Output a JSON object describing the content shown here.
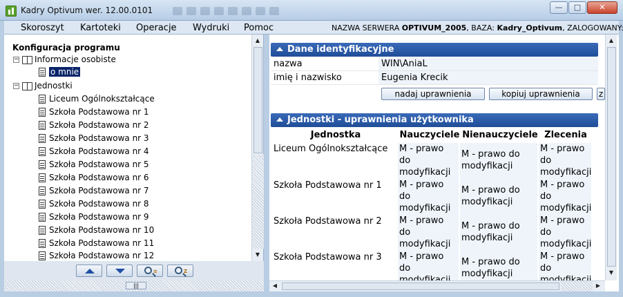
{
  "window": {
    "title": "Kadry Optivum wer. 12.00.0101",
    "minimize_label": "—",
    "maximize_label": "□",
    "close_label": "✕"
  },
  "menu": {
    "items": [
      "Skoroszyt",
      "Kartoteki",
      "Operacje",
      "Wydruki",
      "Pomoc"
    ],
    "server_label": "NAZWA SERWERA",
    "server_value": "OPTIVUM_2005",
    "db_label": ", BAZA:",
    "db_value": "Kadry_Optivum",
    "user_label": ", ZALOGOWANY:"
  },
  "tree": {
    "root": "Konfiguracja programu",
    "group1": "Informacje osobiste",
    "group1_items": [
      "o mnie"
    ],
    "group2": "Jednostki",
    "group2_items": [
      "Liceum Ogólnokształcące",
      "Szkoła Podstawowa nr 1",
      "Szkoła Podstawowa nr 2",
      "Szkoła Podstawowa nr 3",
      "Szkoła Podstawowa nr 4",
      "Szkoła Podstawowa nr 5",
      "Szkoła Podstawowa nr 6",
      "Szkoła Podstawowa nr 7",
      "Szkoła Podstawowa nr 8",
      "Szkoła Podstawowa nr 9",
      "Szkoła Podstawowa nr 10",
      "Szkoła Podstawowa nr 11",
      "Szkoła Podstawowa nr 12"
    ]
  },
  "identity": {
    "header": "Dane identyfikacyjne",
    "rows": [
      {
        "label": "nazwa",
        "value": "WIN\\AniaL"
      },
      {
        "label": "imię i nazwisko",
        "value": "Eugenia Krecik"
      }
    ],
    "grant_button": "nadaj uprawnienia",
    "copy_button": "kopiuj uprawnienia",
    "more_button": "z"
  },
  "permissions": {
    "header": "Jednostki - uprawnienia użytkownika",
    "columns": [
      "Jednostka",
      "Nauczyciele",
      "Nienauczyciele",
      "Zlecenia"
    ],
    "rows": [
      {
        "unit": "Liceum Ogólnokształcące",
        "nauczyciele": [
          "M - prawo",
          "do",
          "modyfikacji"
        ],
        "nienauczyciele": [
          "M - prawo do",
          "modyfikacji"
        ],
        "zlecenia": [
          "M - prawo",
          "do",
          "modyfikacji"
        ]
      },
      {
        "unit": "Szkoła Podstawowa nr 1",
        "nauczyciele": [
          "M - prawo",
          "do",
          "modyfikacji"
        ],
        "nienauczyciele": [
          "M - prawo do",
          "modyfikacji"
        ],
        "zlecenia": [
          "M - prawo",
          "do",
          "modyfikacji"
        ]
      },
      {
        "unit": "Szkoła Podstawowa nr 2",
        "nauczyciele": [
          "M - prawo",
          "do",
          "modyfikacji"
        ],
        "nienauczyciele": [
          "M - prawo do",
          "modyfikacji"
        ],
        "zlecenia": [
          "M - prawo",
          "do",
          "modyfikacji"
        ]
      },
      {
        "unit": "Szkoła Podstawowa nr 3",
        "nauczyciele": [
          "M - prawo",
          "do",
          "modyfikacji"
        ],
        "nienauczyciele": [
          "M - prawo do",
          "modyfikacji"
        ],
        "zlecenia": [
          "M - prawo",
          "do",
          "modyfikacji"
        ]
      }
    ]
  },
  "icons": {
    "app": "kadry-app-icon",
    "book": "book-icon",
    "document": "document-icon",
    "nav_up": "arrow-up-icon",
    "nav_down": "arrow-down-icon",
    "search_1": "search-icon",
    "search_2": "search-icon"
  },
  "colors": {
    "section_header": "#1f4d98",
    "selection": "#0a246a",
    "cell_background": "#eef4fa"
  }
}
